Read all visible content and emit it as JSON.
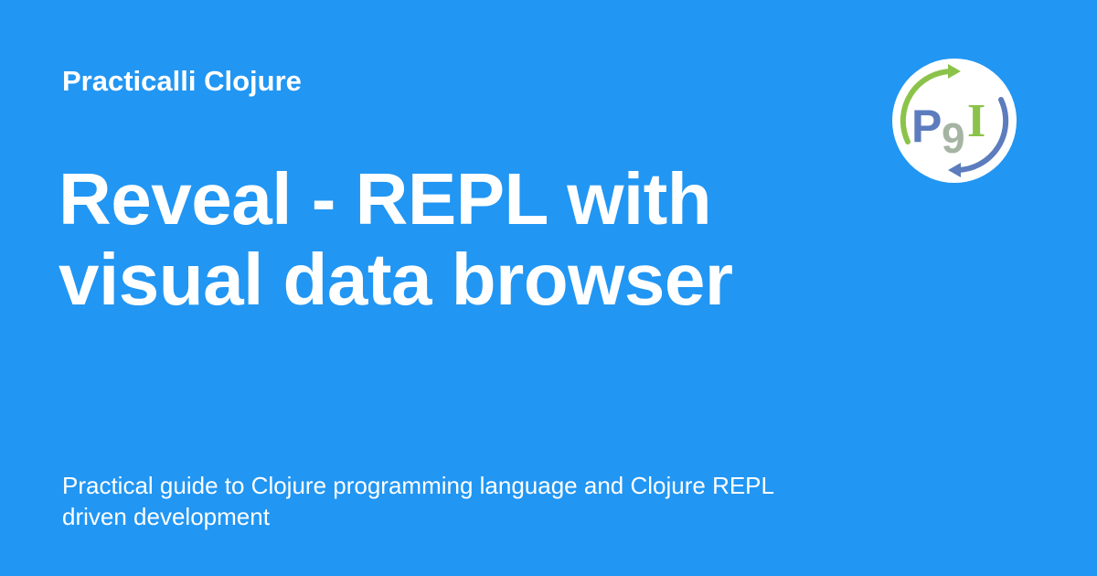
{
  "site": {
    "name": "Practicalli Clojure"
  },
  "page": {
    "title": "Reveal - REPL with visual data browser",
    "description": "Practical guide to Clojure programming language and Clojure REPL driven development"
  },
  "logo": {
    "icon": "practicalli-logo-icon",
    "letters": "P9I"
  },
  "colors": {
    "background": "#2196f3",
    "text": "#ffffff",
    "logo_green": "#8bc34a",
    "logo_blue": "#5c7cbe",
    "logo_grey": "#a5b4a3"
  }
}
